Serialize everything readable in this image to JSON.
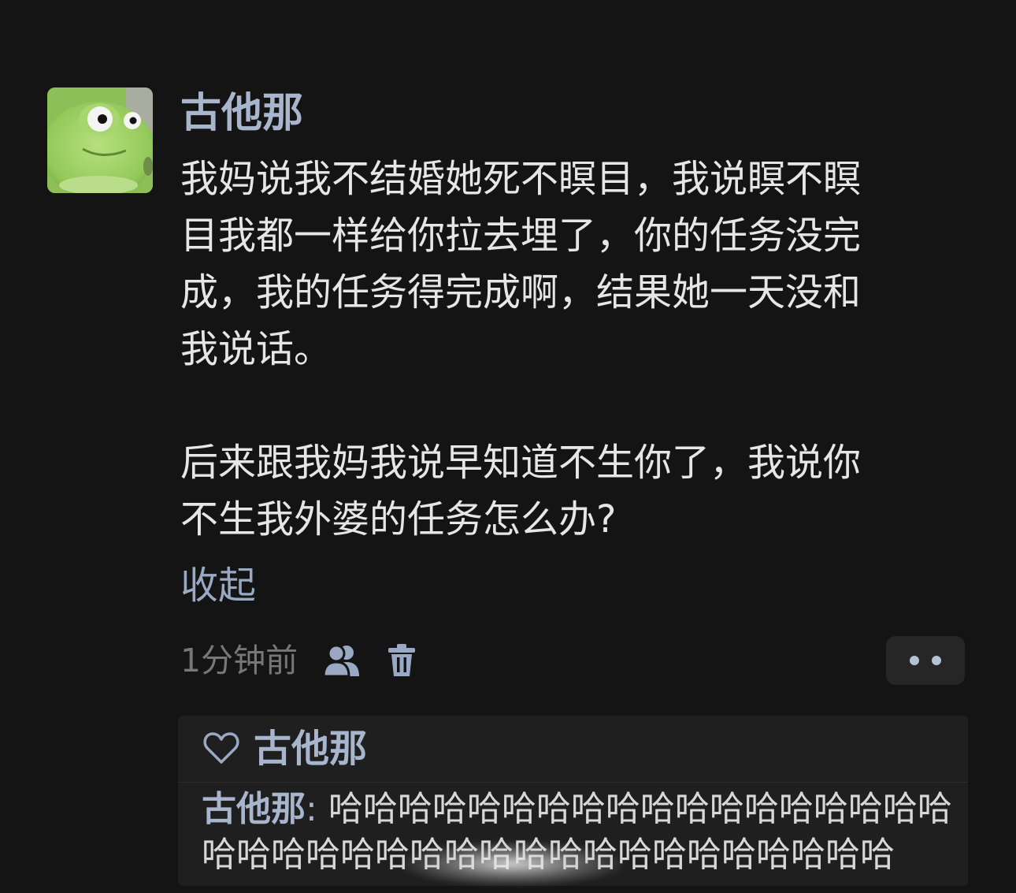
{
  "post": {
    "username": "古他那",
    "paragraphs": [
      "我妈说我不结婚她死不瞑目，我说瞑不瞑",
      "目我都一样给你拉去埋了，你的任务没完",
      "成，我的任务得完成啊，结果她一天没和",
      "我说话。",
      "",
      "后来跟我妈我说早知道不生你了，我说你",
      "不生我外婆的任务怎么办?"
    ],
    "collapse_label": "收起",
    "timestamp": "1分钟前"
  },
  "icons": {
    "avatar": "frog-avatar",
    "visibility": "people-icon",
    "delete": "trash-icon",
    "more": "more-dots-icon",
    "like": "heart-outline-icon"
  },
  "likes": {
    "name": "古他那"
  },
  "reply": {
    "author": "古他那",
    "colon": ":",
    "text": "哈哈哈哈哈哈哈哈哈哈哈哈哈哈哈哈哈哈哈哈哈哈哈哈哈哈哈哈哈哈哈哈哈哈哈哈哈哈"
  },
  "colors": {
    "background": "#141414",
    "name_blue": "#a7b6cd",
    "body_text": "#e6e6e6",
    "muted": "#777777",
    "panel": "#1f1f1f"
  }
}
